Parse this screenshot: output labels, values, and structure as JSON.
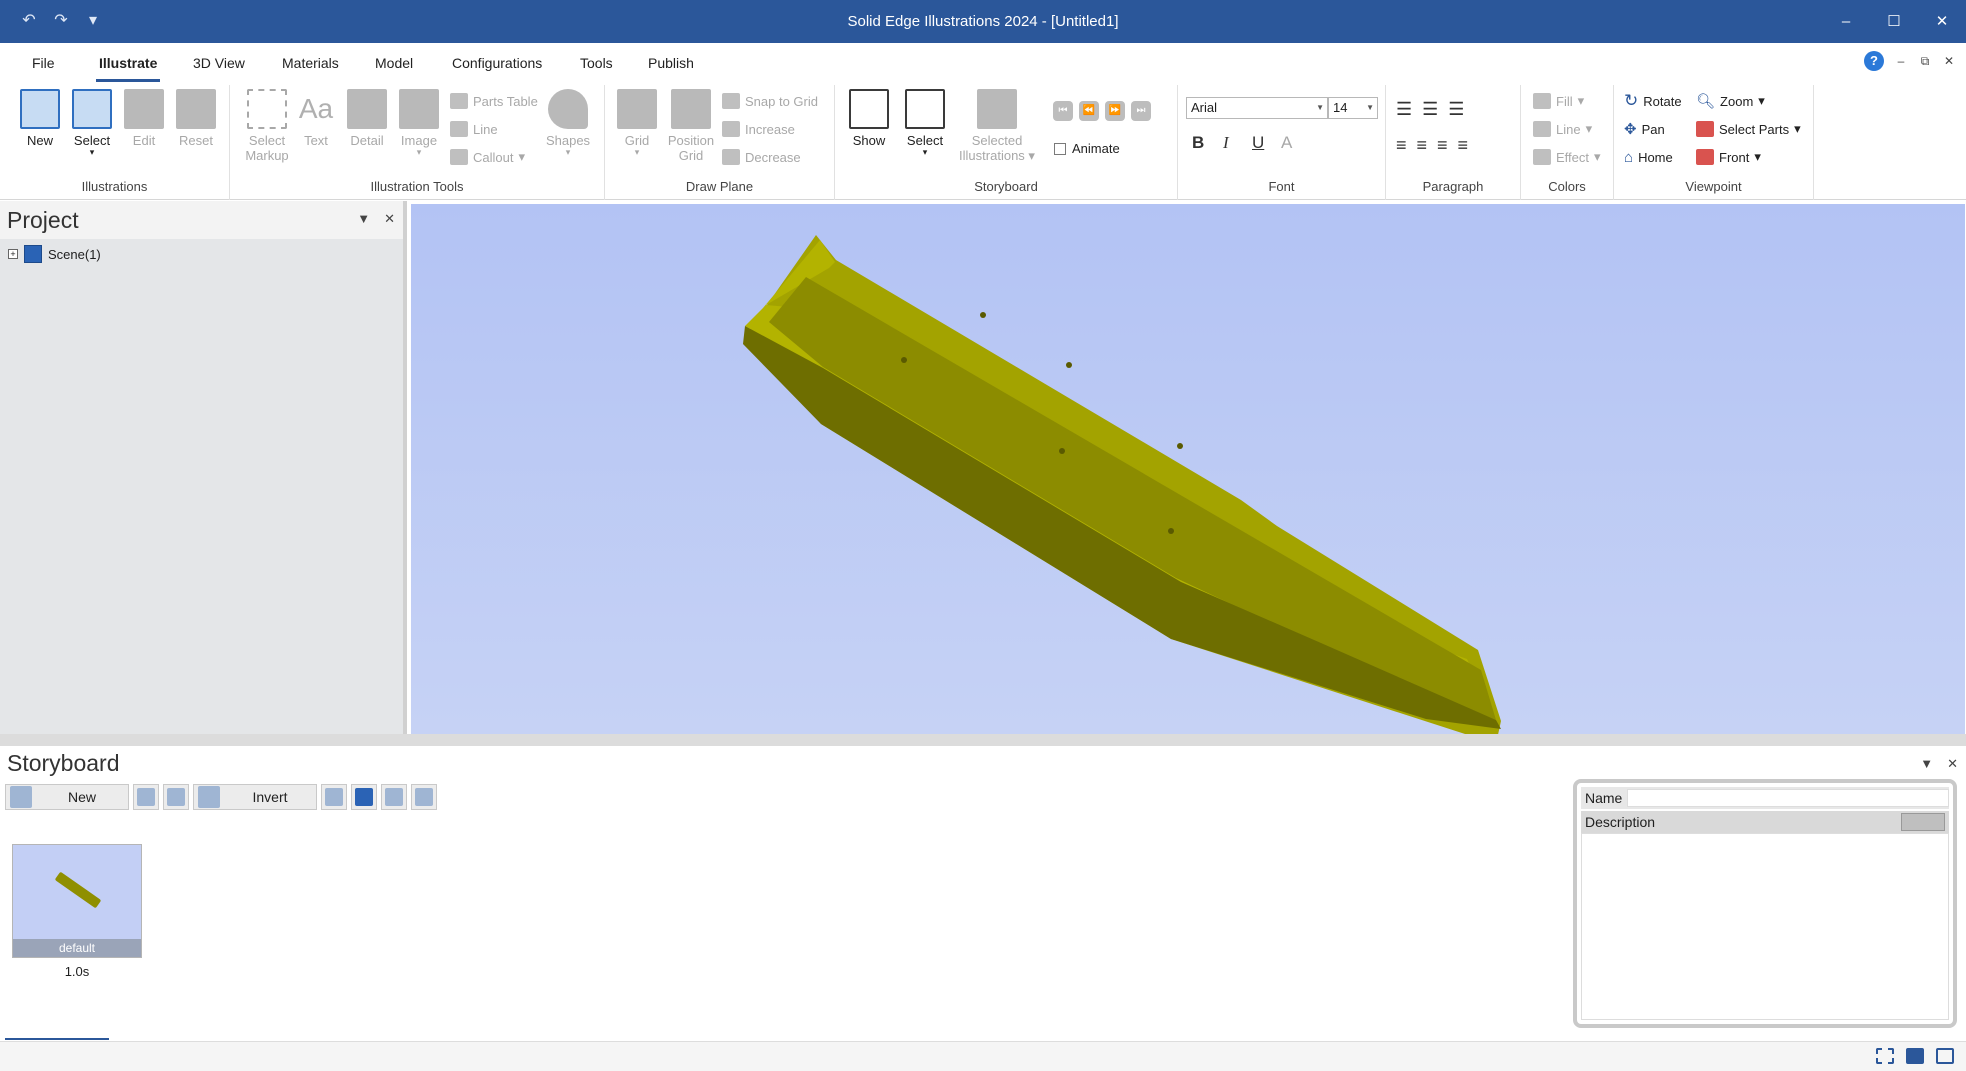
{
  "window": {
    "title": "Solid Edge Illustrations  2024 - [Untitled1]",
    "minimize": "–",
    "maximize": "☐",
    "close": "✕",
    "quick_access": [
      "↶",
      "↷",
      "▾"
    ]
  },
  "menu": {
    "tabs": [
      "File",
      "Illustrate",
      "3D View",
      "Materials",
      "Model",
      "Configurations",
      "Tools",
      "Publish"
    ],
    "active_tab": "Illustrate",
    "help": "?",
    "doc_controls": [
      "–",
      "⧉",
      "✕"
    ]
  },
  "ribbon": {
    "illustrations": {
      "label": "Illustrations",
      "new": "New",
      "select": "Select",
      "edit": "Edit",
      "reset": "Reset"
    },
    "illustration_tools": {
      "label": "Illustration Tools",
      "select_markup_1": "Select",
      "select_markup_2": "Markup",
      "text": "Text",
      "detail": "Detail",
      "image": "Image",
      "parts_table": "Parts Table",
      "line": "Line",
      "callout": "Callout",
      "shapes": "Shapes"
    },
    "draw_plane": {
      "label": "Draw Plane",
      "grid": "Grid",
      "position_grid_1": "Position",
      "position_grid_2": "Grid",
      "snap_to_grid": "Snap to Grid",
      "increase": "Increase",
      "decrease": "Decrease"
    },
    "storyboard": {
      "label": "Storyboard",
      "show": "Show",
      "select": "Select",
      "selected_illustrations_1": "Selected",
      "selected_illustrations_2": "Illustrations",
      "animate": "Animate"
    },
    "font": {
      "label": "Font",
      "family": "Arial",
      "size": "14",
      "bold": "B",
      "italic": "I",
      "underline": "U",
      "color": "A"
    },
    "paragraph": {
      "label": "Paragraph"
    },
    "colors": {
      "label": "Colors",
      "fill": "Fill",
      "line": "Line",
      "effect": "Effect"
    },
    "viewpoint": {
      "label": "Viewpoint",
      "rotate": "Rotate",
      "pan": "Pan",
      "home": "Home",
      "zoom": "Zoom",
      "select_parts": "Select Parts",
      "front": "Front"
    }
  },
  "project": {
    "title": "Project",
    "tree": [
      {
        "label": "Scene(1)",
        "expander": "+"
      }
    ]
  },
  "storyboard_panel": {
    "title": "Storyboard",
    "new": "New",
    "invert": "Invert",
    "thumbnail_caption": "default",
    "duration": "1.0s",
    "name_label": "Name",
    "description_label": "Description"
  },
  "colors": {
    "title_bar": "#2b579a",
    "viewport_bg": "#b8c6f4",
    "part_color": "#9c9c00"
  }
}
